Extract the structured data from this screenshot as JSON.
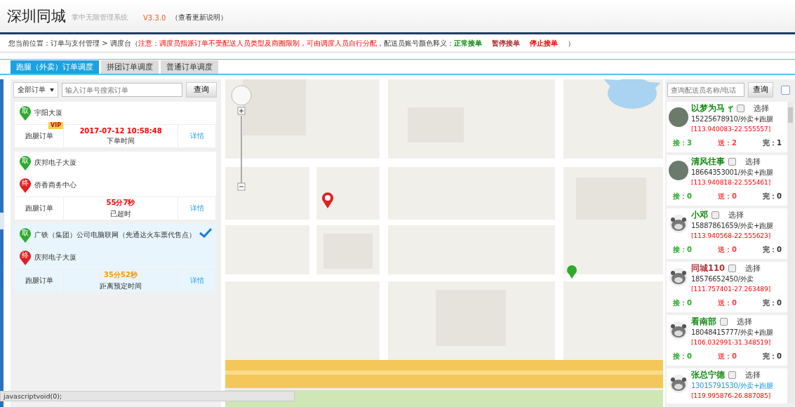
{
  "header": {
    "logo": "深圳同城",
    "subtitle": "掌中无限管理系统",
    "version": "V3.3.0",
    "changelog_link": "（查看更新说明）"
  },
  "breadcrumb": {
    "location": "您当前位置：订单与支付管理 > 调度台（",
    "notice": "注意：调度员指派订单不受配送人员类型及商圈限制，可由调度人员自行分配",
    "legend_label": "，配送员账号颜色释义：",
    "legend": [
      {
        "label": "正常接单",
        "color": "#118811"
      },
      {
        "label": "暂停接单",
        "color": "#b03030"
      },
      {
        "label": "停止接单",
        "color": "#ff0000"
      }
    ],
    "close": "）"
  },
  "tabs": [
    {
      "label": "跑腿（外卖）订单调度",
      "selected": true
    },
    {
      "label": "拼团订单调度",
      "selected": false
    },
    {
      "label": "普通订单调度",
      "selected": false
    }
  ],
  "orders": {
    "filter": "全部订单",
    "search": {
      "placeholder": "输入订单号搜索订单"
    },
    "search_button": "查询",
    "items": [
      {
        "selected": false,
        "stops": [
          {
            "kind": "pickup",
            "marker": "取",
            "address": "宇阳大厦"
          }
        ],
        "type": "跑腿订单",
        "badge": "VIP",
        "time": "2017-07-12  10:58:48",
        "color": "#ff0000",
        "time_label": "下单时间",
        "detail": "详情"
      },
      {
        "selected": false,
        "stops": [
          {
            "kind": "pickup",
            "marker": "取",
            "address": "庆邦电子大厦"
          },
          {
            "kind": "dropoff",
            "marker": "终",
            "address": "侨香商务中心"
          }
        ],
        "type": "跑腿订单",
        "time": "55分7秒",
        "color": "#ff0000",
        "time_label": "已超时",
        "detail": "详情"
      },
      {
        "selected": true,
        "stops": [
          {
            "kind": "pickup",
            "marker": "取",
            "address": "广铁（集团）公司电脑联网（先通达火车票代售点）"
          },
          {
            "kind": "dropoff",
            "marker": "终",
            "address": "庆邦电子大厦"
          }
        ],
        "type": "跑腿订单",
        "time": "35分52秒",
        "color": "#f39800",
        "time_label": "距离预定时间",
        "detail": "详情"
      }
    ]
  },
  "couriers": {
    "search": {
      "placeholder": "查询配送员名称/电话"
    },
    "search_button": "查询",
    "select_all": {
      "checked": false
    },
    "items": [
      {
        "kind": "photo",
        "name": "以梦为马",
        "badge": true,
        "color": "#118811",
        "checked": false,
        "select_label": "选择",
        "contact": "15225678910/外卖+跑腿",
        "hovered": false,
        "position": "[113.940083-22.555557]",
        "stats": [
          "接：3",
          "送：2",
          "完：1"
        ]
      },
      {
        "kind": "photo",
        "name": "清风往事",
        "badge": false,
        "color": "#118811",
        "checked": false,
        "select_label": "选择",
        "contact": "18664353001/外卖+跑腿",
        "hovered": false,
        "position": "[113.940818-22.555461]",
        "stats": [
          "接：0",
          "送：0",
          "完：0"
        ]
      },
      {
        "kind": "default",
        "name": "小邓",
        "badge": false,
        "color": "#118811",
        "checked": false,
        "select_label": "选择",
        "contact": "15887861659/外卖+跑腿",
        "hovered": false,
        "position": "[113.940568-22.555623]",
        "stats": [
          "接：0",
          "送：0",
          "完：0"
        ]
      },
      {
        "kind": "default",
        "name": "同城110",
        "badge": false,
        "color": "#b03030",
        "checked": false,
        "select_label": "选择",
        "contact": "18576652450/外卖",
        "hovered": false,
        "position": "[111.757401-27.263489]",
        "stats": [
          "接：0",
          "送：0",
          "完：0"
        ]
      },
      {
        "kind": "default",
        "name": "看南部",
        "badge": false,
        "color": "#118811",
        "checked": false,
        "select_label": "选择",
        "contact": "18048415777/外卖+跑腿",
        "hovered": false,
        "position": "[106.032991-31.348519]",
        "stats": [
          "接：0",
          "送：0",
          "完：0"
        ]
      },
      {
        "kind": "default",
        "name": "张总宁德",
        "badge": false,
        "color": "#118811",
        "checked": false,
        "select_label": "选择",
        "contact": "13015791530/外卖+跑腿",
        "hovered": true,
        "position": "[119.995876-26.887085]"
      }
    ]
  },
  "status_bar": "javascriptvoid(0);"
}
